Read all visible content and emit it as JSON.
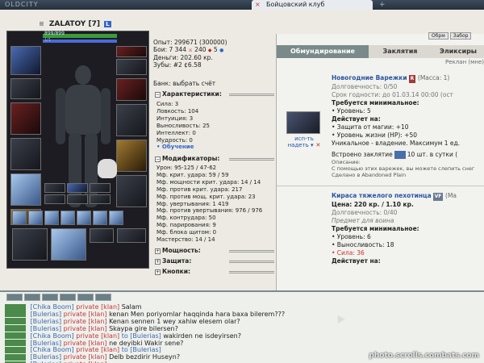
{
  "browser": {
    "brand": "OLDCITY",
    "tab_title": "Бойцовский клуб",
    "tab_close": "×",
    "new_tab": "+"
  },
  "character": {
    "mark": "≡",
    "name": "ZALATOY",
    "level": "[7]",
    "badge": "L",
    "hp": "899/899",
    "hp_fraction": 1.0,
    "mp": "1/1",
    "mp_fraction": 1.0
  },
  "stats": {
    "exp": "Опыт: 299671 (300000)",
    "battles": "Бои: 7 344",
    "wins": "240",
    "draws": "5",
    "money": "Деньги: 202.60 кр.",
    "teeth": "Зубы: #2 ¢6.58"
  },
  "bank": {
    "label": "Банк: ",
    "link": "выбрать счёт"
  },
  "sections": {
    "characteristics": "Характеристики:",
    "modifiers": "Модификаторы:",
    "power": "Мощность:",
    "protection": "Защита:",
    "buttons": "Кнопки:"
  },
  "characteristics": [
    "Сила: 3",
    "Ловкость: 104",
    "Интуиция: 3",
    "Выносливость: 25",
    "Интеллект: 0",
    "Мудрость: 0"
  ],
  "learn": "• Обучение",
  "modifiers": [
    "Урон: 95-125 / 47-62",
    "Мф. крит. удара: 59 / 59",
    "Мф. мощности крит. удара: 14 / 14",
    "Мф. против крит. удара: 217",
    "Мф. против мощ. крит. удара: 23",
    "Мф. увертывания: 1 419",
    "Мф. против увертывания: 976 / 976",
    "Мф. контрудара: 50",
    "Мф. парирования: 9",
    "Мф. блока щитом: 0",
    "Мастерство: 14 / 14"
  ],
  "inventory": {
    "buttons": [
      "Обрм",
      "Забор"
    ],
    "tabs": [
      "Обмундирование",
      "Заклятия",
      "Эликсиры"
    ],
    "filter": "Реклан (мне)",
    "item1": {
      "title": "Новогодние Варежки",
      "tag": "R",
      "mass": "(Масса: 1)",
      "durability": "Долговечность: 0/50",
      "expiry": "Срок годности: до 01.03.14 00:00 (ост",
      "req_header": "Требуется минимальное:",
      "req_level": "• Уровень: 5",
      "acts_header": "Действует на:",
      "act1": "• Защита от магии: +10",
      "act2": "• Уровень жизни (HP): +50",
      "unique": "Уникальное - владение. Максимум 1 ед.",
      "spell_pre": "Встроено заклятие",
      "spell_post": "10 шт. в сутки (",
      "desc_header": "Описание:",
      "desc": "С помощью этих варежек, вы можете слепить снег",
      "made": "Сделано в Abandoned Plain",
      "action_use": "исп-ть",
      "action_wear": "надеть",
      "action_del": "✕"
    },
    "item2": {
      "title": "Кираса тяжелого пехотинца",
      "tag": "VF",
      "mass": "(Ма",
      "price": "Цена: 220 кр. / 1.10 кр.",
      "durability": "Долговечность: 0/40",
      "for": "Предмет для воина",
      "req_header": "Требуется минимальное:",
      "req1": "• Уровень: 6",
      "req2": "• Выносливость: 18",
      "req3": "• Сила: 36",
      "acts_header": "Действует на:"
    }
  },
  "chat": [
    {
      "nick": "[Chika Boom]",
      "priv": "private [klan]",
      "to": "",
      "text": "Salam"
    },
    {
      "nick": "[Bulerias]",
      "priv": "private [klan]",
      "to": "",
      "text": "kenan Men poriyomlar haqqinda hara baxa bilerem???"
    },
    {
      "nick": "[Bulerias]",
      "priv": "private [klan]",
      "to": "",
      "text": "Kenan sennen 1 wey xahiw elesem olar?"
    },
    {
      "nick": "[Bulerias]",
      "priv": "private [klan]",
      "to": "",
      "text": "Skaypa gire bilersen?"
    },
    {
      "nick": "[Chika Boom]",
      "priv": "private [klan]",
      "to": "to [Bulerias]",
      "text": "wakirden ne isdeyirsen?"
    },
    {
      "nick": "[Bulerias]",
      "priv": "private [klan]",
      "to": "",
      "text": "ne deyibki Wakir sene?"
    },
    {
      "nick": "[Chika Boom]",
      "priv": "private [klan]",
      "to": "to [Bulerias]",
      "text": ""
    },
    {
      "nick": "[Bulerias]",
      "priv": "private [klan]",
      "to": "",
      "text": "Delb bezdirir Huseyn?"
    },
    {
      "nick": "[Bulerias]",
      "priv": "private [klan]",
      "to": "",
      "text": ""
    }
  ],
  "watermark": "photo.scrolls.combats.com",
  "colors": {
    "accent_blue": "#3366cc",
    "private_red": "#c23a3a",
    "panel_bg": "#eceae2"
  }
}
